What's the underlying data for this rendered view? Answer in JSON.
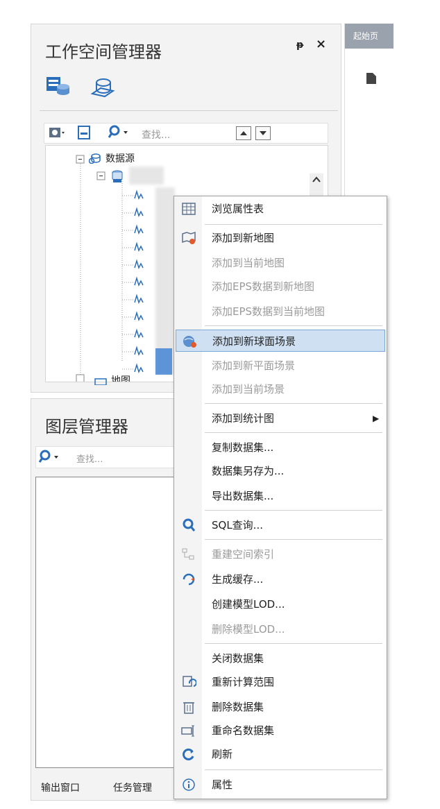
{
  "workspace_panel": {
    "title": "工作空间管理器",
    "pin": "ᵽ",
    "close": "×",
    "search_placeholder": "查找...",
    "tree": {
      "datasource_label": "数据源",
      "map_label": "地图"
    }
  },
  "layer_panel": {
    "title": "图层管理器",
    "search_placeholder": "查找..."
  },
  "bottom_tabs": [
    "输出窗口",
    "任务管理"
  ],
  "doc_area": {
    "tab": "起始页"
  },
  "context_menu": {
    "items": [
      {
        "label": "浏览属性表",
        "disabled": false,
        "icon": "table-icon"
      },
      {
        "label": "添加到新地图",
        "disabled": false,
        "icon": "add-map-icon"
      },
      {
        "label": "添加到当前地图",
        "disabled": true
      },
      {
        "label": "添加EPS数据到新地图",
        "disabled": true
      },
      {
        "label": "添加EPS数据到当前地图",
        "disabled": true
      },
      {
        "label": "添加到新球面场景",
        "disabled": false,
        "highlighted": true,
        "icon": "globe-scene-icon"
      },
      {
        "label": "添加到新平面场景",
        "disabled": true
      },
      {
        "label": "添加到当前场景",
        "disabled": true
      },
      {
        "label": "添加到统计图",
        "disabled": false,
        "submenu": true
      },
      {
        "label": "复制数据集...",
        "disabled": false
      },
      {
        "label": "数据集另存为...",
        "disabled": false
      },
      {
        "label": "导出数据集...",
        "disabled": false
      },
      {
        "label": "SQL查询...",
        "disabled": false,
        "icon": "search-icon"
      },
      {
        "label": "重建空间索引",
        "disabled": true,
        "icon": "spatial-index-icon"
      },
      {
        "label": "生成缓存...",
        "disabled": false,
        "icon": "cache-icon"
      },
      {
        "label": "创建模型LOD...",
        "disabled": false
      },
      {
        "label": "删除模型LOD...",
        "disabled": true
      },
      {
        "label": "关闭数据集",
        "disabled": false
      },
      {
        "label": "重新计算范围",
        "disabled": false,
        "icon": "recalc-icon"
      },
      {
        "label": "删除数据集",
        "disabled": false,
        "icon": "trash-icon"
      },
      {
        "label": "重命名数据集",
        "disabled": false,
        "icon": "rename-icon"
      },
      {
        "label": "刷新",
        "disabled": false,
        "icon": "refresh-icon"
      },
      {
        "label": "属性",
        "disabled": false,
        "icon": "info-icon"
      }
    ]
  },
  "colors": {
    "highlight": "#cfe0f3",
    "disabled_text": "#9a9a9a",
    "icon_blue": "#2a6ebb"
  }
}
